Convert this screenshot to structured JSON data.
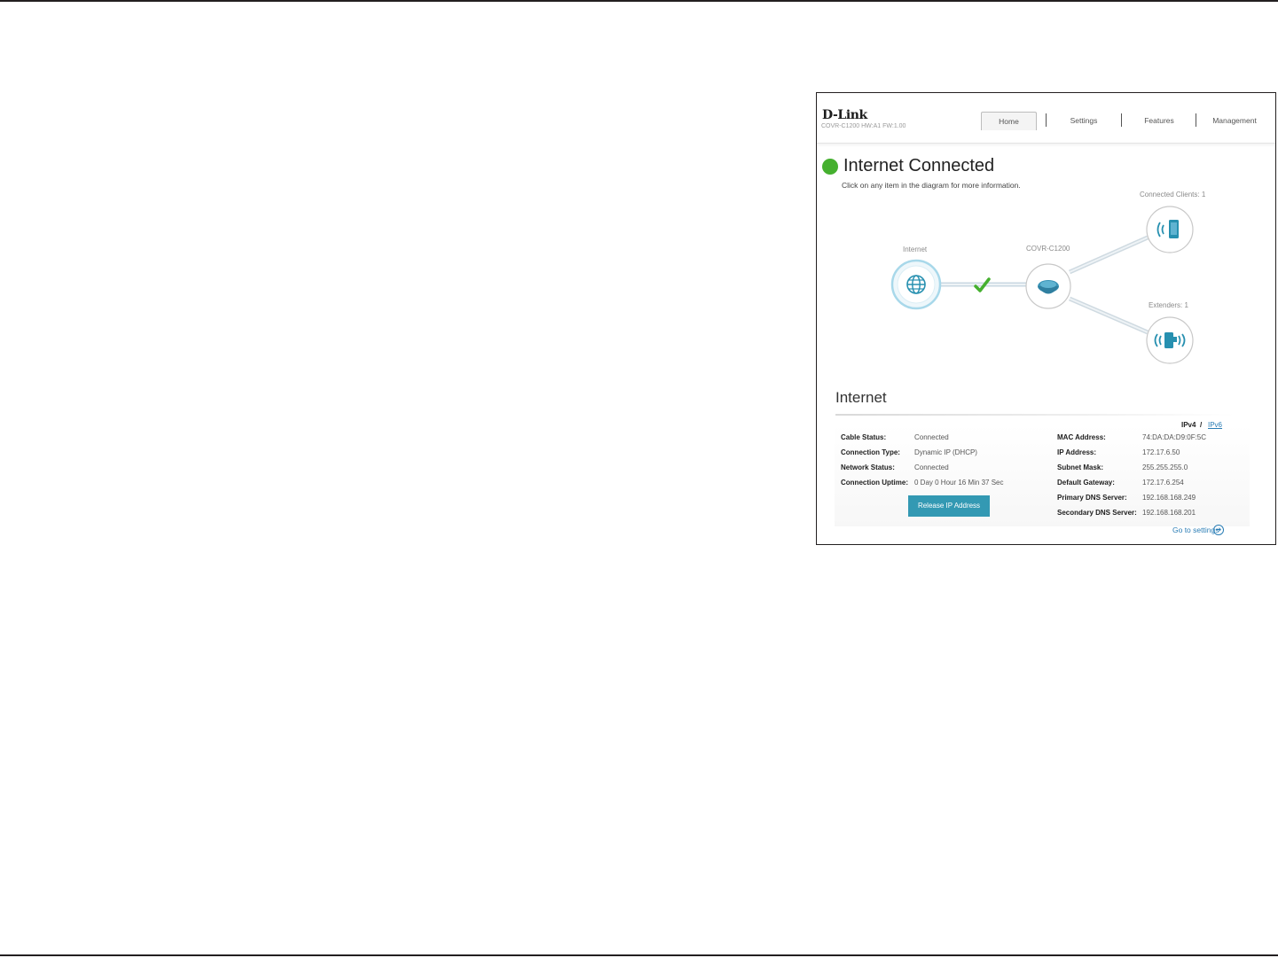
{
  "header": {
    "logo": "D-Link",
    "model": "COVR-C1200 HW:A1 FW:1.00",
    "tabs": [
      {
        "label": "Home",
        "active": true
      },
      {
        "label": "Settings",
        "active": false
      },
      {
        "label": "Features",
        "active": false
      },
      {
        "label": "Management",
        "active": false
      }
    ]
  },
  "status": {
    "title": "Internet Connected",
    "hint": "Click on any item in the diagram for more information.",
    "color": "#45b02f"
  },
  "diagram": {
    "internet_label": "Internet",
    "router_label": "COVR-C1200",
    "clients_label": "Connected Clients: 1",
    "extenders_label": "Extenders: 1",
    "internet_icon": "globe-icon",
    "router_icon": "covr-router-icon",
    "clients_icon": "phone-wireless-icon",
    "extenders_icon": "extender-wireless-icon",
    "link_status_icon": "checkmark-icon"
  },
  "internet": {
    "section_title": "Internet",
    "ipv4": "IPv4",
    "separator": "/",
    "ipv6": "IPv6",
    "left": [
      {
        "label": "Cable Status:",
        "value": "Connected"
      },
      {
        "label": "Connection Type:",
        "value": "Dynamic IP (DHCP)"
      },
      {
        "label": "Network Status:",
        "value": "Connected"
      },
      {
        "label": "Connection Uptime:",
        "value": "0 Day 0 Hour 16 Min 37 Sec"
      }
    ],
    "right": [
      {
        "label": "MAC Address:",
        "value": "74:DA:DA:D9:0F:5C"
      },
      {
        "label": "IP Address:",
        "value": "172.17.6.50"
      },
      {
        "label": "Subnet Mask:",
        "value": "255.255.255.0"
      },
      {
        "label": "Default Gateway:",
        "value": "172.17.6.254"
      },
      {
        "label": "Primary DNS Server:",
        "value": "192.168.168.249"
      },
      {
        "label": "Secondary DNS Server:",
        "value": "192.168.168.201"
      }
    ],
    "release_button": "Release IP Address",
    "go_to_settings": "Go to settings"
  },
  "colors": {
    "accent": "#3399b3",
    "link": "#2a7db5",
    "connected": "#45b02f"
  }
}
